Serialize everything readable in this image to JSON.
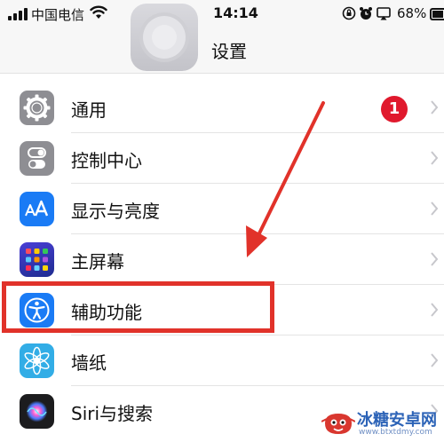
{
  "status_bar": {
    "carrier": "中国电信",
    "time": "14:14",
    "battery": "68%"
  },
  "header": {
    "title": "设置"
  },
  "settings": {
    "items": [
      {
        "label": "通用",
        "icon": "gear-icon",
        "badge": "1"
      },
      {
        "label": "控制中心",
        "icon": "toggle-switches-icon"
      },
      {
        "label": "显示与亮度",
        "icon": "text-size-icon"
      },
      {
        "label": "主屏幕",
        "icon": "app-grid-icon"
      },
      {
        "label": "辅助功能",
        "icon": "accessibility-icon"
      },
      {
        "label": "墙纸",
        "icon": "flower-icon"
      },
      {
        "label": "Siri与搜索",
        "icon": "siri-icon"
      }
    ]
  },
  "colors": {
    "highlight": "#e1322a",
    "badge": "#e0192d",
    "accessibility_blue": "#1a7bf5"
  },
  "watermark": {
    "title": "冰糖安卓网",
    "url": "www.btxtdmy.com"
  }
}
